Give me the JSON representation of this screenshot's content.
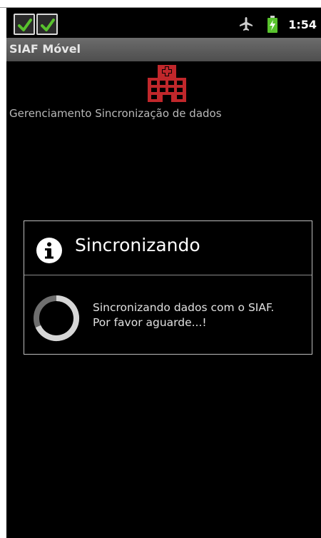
{
  "status_bar": {
    "notification_icons": [
      "check-icon",
      "check-icon"
    ],
    "time": "1:54",
    "icons": [
      "airplane-icon",
      "battery-charging-icon"
    ]
  },
  "app_bar": {
    "title": "SIAF Móvel"
  },
  "content": {
    "app_icon": "hospital-building-icon",
    "subtitle": "Gerenciamento Sincronização de dados"
  },
  "dialog": {
    "icon": "info-icon",
    "title": "Sincronizando",
    "message": "Sincronizando dados com o SIAF.\nPor favor aguarde...!",
    "spinner": "progress-spinner-icon"
  },
  "colors": {
    "screen_background": "#000000",
    "title_bar": "#5a5a5a",
    "icon_red": "#c0272b",
    "check_green": "#58c22d"
  }
}
